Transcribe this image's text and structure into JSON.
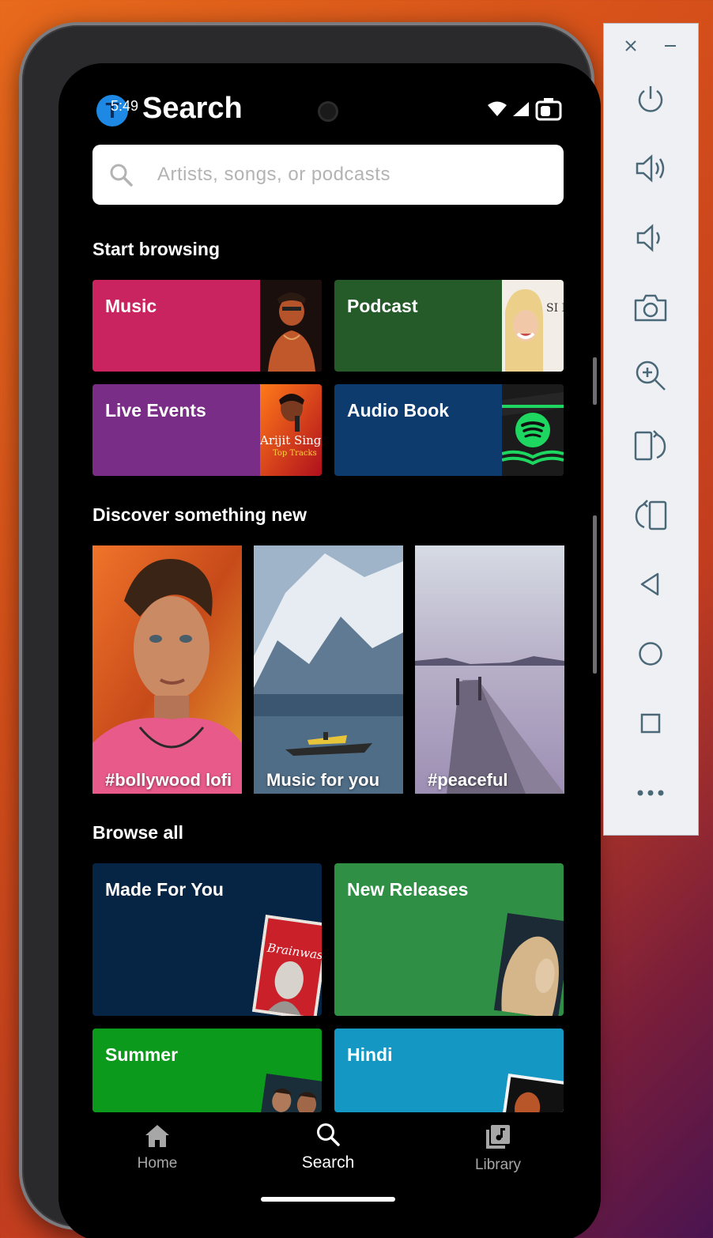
{
  "status_bar": {
    "time": "5:49",
    "app_badge_letter": "T"
  },
  "header": {
    "title": "Search"
  },
  "search": {
    "placeholder": "Artists, songs, or podcasts"
  },
  "sections": {
    "start_browsing": "Start browsing",
    "discover": "Discover something new",
    "browse_all": "Browse all"
  },
  "start_browsing_tiles": [
    {
      "label": "Music",
      "color": "#c9245f"
    },
    {
      "label": "Podcast",
      "color": "#245b28"
    },
    {
      "label": "Live Events",
      "color": "#7a2d86"
    },
    {
      "label": "Audio Book",
      "color": "#0d3b6e"
    }
  ],
  "thumb_text": {
    "live_events_line1": "Arijit Singh",
    "live_events_line2": "Top Tracks",
    "podcast_cover": "SI IMI"
  },
  "discover_cards": [
    {
      "label": "#bollywood lofi"
    },
    {
      "label": "Music for you"
    },
    {
      "label": "#peaceful"
    }
  ],
  "browse_all_tiles": [
    {
      "label": "Made For You",
      "color": "#062544",
      "art_text": "Brainwash"
    },
    {
      "label": "New Releases",
      "color": "#2f8f45"
    },
    {
      "label": "Summer",
      "color": "#0b9a1c"
    },
    {
      "label": "Hindi",
      "color": "#1597c4"
    }
  ],
  "bottom_nav": [
    {
      "label": "Home",
      "icon": "home-icon",
      "active": false
    },
    {
      "label": "Search",
      "icon": "search-icon",
      "active": true
    },
    {
      "label": "Library",
      "icon": "library-icon",
      "active": false
    }
  ],
  "emulator_controls": [
    "close-icon",
    "minimize-icon",
    "power-icon",
    "volume-up-icon",
    "volume-down-icon",
    "camera-icon",
    "zoom-in-icon",
    "rotate-right-icon",
    "rotate-left-icon",
    "back-icon",
    "home-circle-icon",
    "overview-icon",
    "more-icon"
  ]
}
